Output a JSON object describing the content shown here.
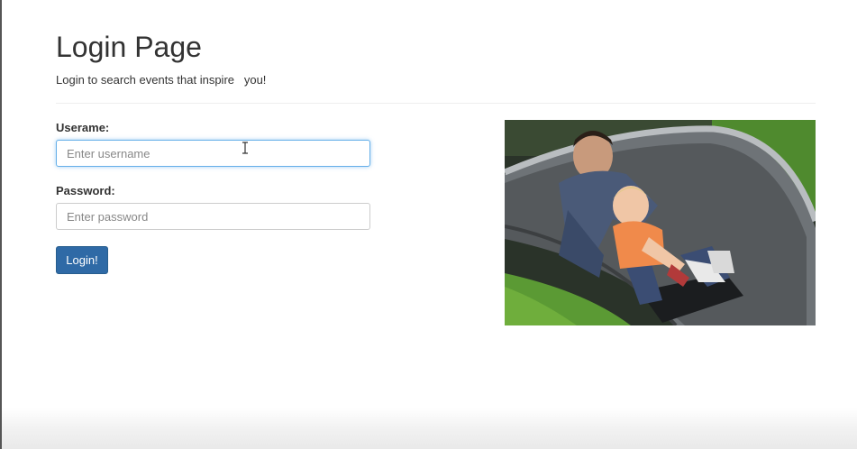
{
  "page": {
    "title": "Login Page",
    "subtitle": "Login to search events that inspire   you!"
  },
  "form": {
    "username_label": "Userame:",
    "username_placeholder": "Enter username",
    "username_value": "",
    "password_label": "Password:",
    "password_placeholder": "Enter password",
    "password_value": "",
    "submit_label": "Login!"
  },
  "colors": {
    "button": "#2f6aa6",
    "focus_border": "#66afe9",
    "text": "#333333"
  },
  "icons": {
    "cursor": "text-cursor-icon"
  },
  "image": {
    "subject": "hero-photo"
  }
}
